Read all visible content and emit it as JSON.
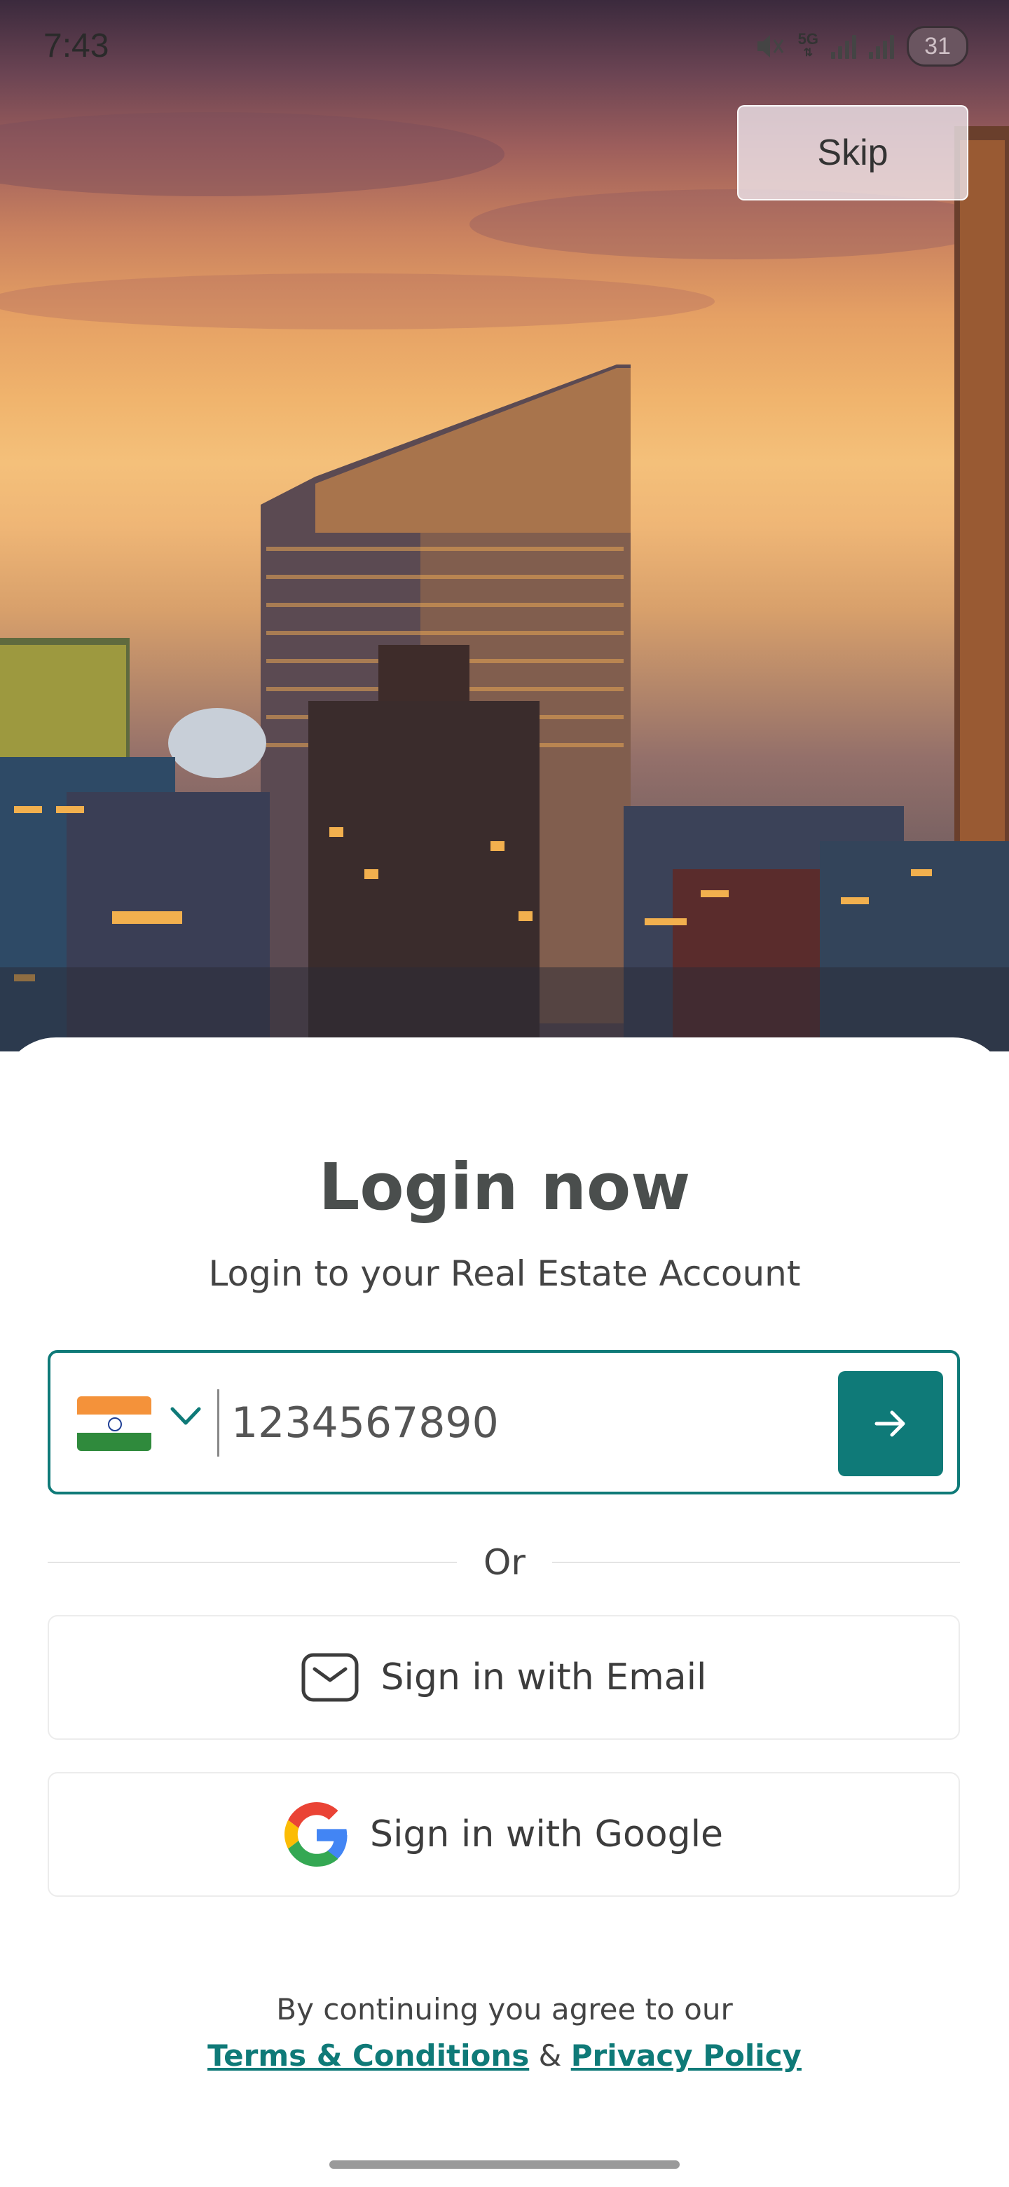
{
  "status_bar": {
    "time": "7:43",
    "network": "5G",
    "battery": "31"
  },
  "skip": {
    "label": "Skip"
  },
  "login": {
    "title": "Login now",
    "subtitle": "Login to your Real Estate Account"
  },
  "phone": {
    "country_flag": "flag-india-icon",
    "value": "1234567890",
    "submit_icon": "arrow-right-icon"
  },
  "divider": {
    "label": "Or"
  },
  "email_signin": {
    "label": "Sign in with Email",
    "icon": "mail-icon"
  },
  "google_signin": {
    "label": "Sign in with Google",
    "icon": "google-icon"
  },
  "footer": {
    "agree_text": "By continuing you agree to our",
    "terms_label": "Terms & Conditions",
    "and_text": "&",
    "privacy_label": "Privacy Policy"
  },
  "colors": {
    "accent": "#0f7a78",
    "title": "#4a4e4d"
  }
}
